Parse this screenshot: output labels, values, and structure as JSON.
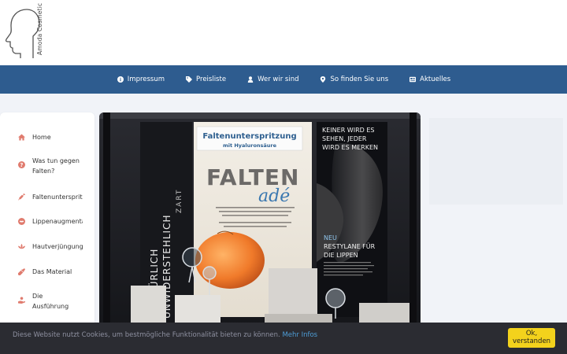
{
  "brand": {
    "name": "Amoda Cosmetic"
  },
  "nav": {
    "items": [
      {
        "label": "Impressum",
        "icon": "info-icon"
      },
      {
        "label": "Preisliste",
        "icon": "tag-icon"
      },
      {
        "label": "Wer wir sind",
        "icon": "user-icon"
      },
      {
        "label": "So finden Sie uns",
        "icon": "map-marker-icon"
      },
      {
        "label": "Aktuelles",
        "icon": "newspaper-icon"
      }
    ]
  },
  "sidebar": {
    "items": [
      {
        "label": "Home",
        "icon": "home-icon"
      },
      {
        "label": "Was tun gegen Falten?",
        "icon": "question-icon"
      },
      {
        "label": "Faltenunterspritzung",
        "icon": "syringe-icon"
      },
      {
        "label": "Lippenaugmentation",
        "icon": "lips-icon"
      },
      {
        "label": "Hautverjüngung",
        "icon": "lotus-icon"
      },
      {
        "label": "Das Material",
        "icon": "eyedropper-icon"
      },
      {
        "label": "Die Ausführung",
        "icon": "hand-icon"
      }
    ]
  },
  "photo": {
    "top_sign": "Faltenunterspritzung",
    "top_sign_sub": "mit Hyaluronsäure",
    "headline_a": "FALTEN",
    "headline_b": "adé",
    "left_banner_1": "NATÜRLICH",
    "left_banner_2": "UNWIDERSTEHLICH",
    "left_banner_3": "ZART",
    "right_top_1": "KEINER WIRD ES",
    "right_top_2": "SEHEN, JEDER",
    "right_top_3": "WIRD ES MERKEN",
    "right_neu": "NEU",
    "right_product_1": "RESTYLANE FÜR",
    "right_product_2": "DIE LIPPEN"
  },
  "cookie": {
    "text": "Diese Website nutzt Cookies, um bestmögliche Funktionalität bieten zu können.",
    "link": "Mehr Infos",
    "button_line1": "Ok,",
    "button_line2": "verstanden"
  },
  "colors": {
    "navbar": "#2e5c8f",
    "sidebar_icon": "#e07b6e",
    "cookie_bg": "#2b2c32",
    "cookie_button": "#f3d21c",
    "cookie_link": "#4e9dd6"
  }
}
